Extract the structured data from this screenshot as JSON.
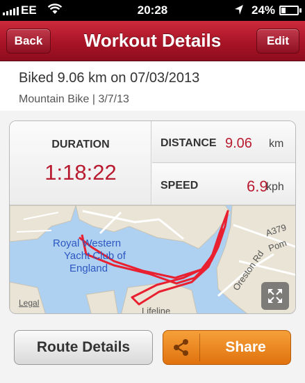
{
  "status_bar": {
    "carrier": "EE",
    "time": "20:28",
    "battery": "24%",
    "icons": [
      "signal-icon",
      "wifi-icon",
      "location-arrow-icon",
      "battery-icon"
    ]
  },
  "navbar": {
    "back_label": "Back",
    "title": "Workout Details",
    "edit_label": "Edit"
  },
  "workout": {
    "title": "Biked 9.06 km on 07/03/2013",
    "subtitle": "Mountain Bike | 3/7/13"
  },
  "stats": {
    "duration_label": "DURATION",
    "duration_value": "1:18:22",
    "distance_label": "DISTANCE",
    "distance_value": "9.06",
    "distance_unit": "km",
    "speed_label": "SPEED",
    "speed_value": "6.9",
    "speed_unit": "kph"
  },
  "map": {
    "place_label_1": "Royal Western",
    "place_label_2": "Yacht Club of",
    "place_label_3": "England",
    "road_label_1": "A379",
    "road_label_2": "Pom",
    "road_label_3": "Oreston Rd",
    "area_label": "Lifeline",
    "legal": "Legal",
    "route_color": "#e8202f",
    "expand_icon": "expand-icon"
  },
  "actions": {
    "route_details_label": "Route Details",
    "share_label": "Share",
    "share_icon": "share-icon"
  },
  "colors": {
    "brand_red": "#a81426",
    "value_red": "#b81b2f",
    "share_orange": "#e8830f"
  }
}
